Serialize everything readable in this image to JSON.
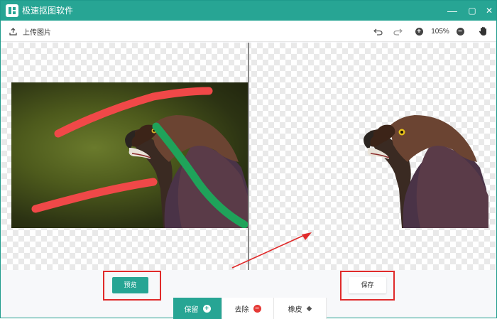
{
  "app": {
    "title": "极速抠图软件"
  },
  "window": {
    "minimize_glyph": "—",
    "maximize_glyph": "▢",
    "close_glyph": "✕"
  },
  "toolbar": {
    "upload_label": "上传图片",
    "zoom_level": "105%",
    "zoom_in_glyph": "+",
    "zoom_out_glyph": "−"
  },
  "actions": {
    "preview_label": "预览",
    "save_label": "保存"
  },
  "tools": [
    {
      "label": "保留",
      "icon": "plus-circle-icon",
      "glyph": "+",
      "active": true
    },
    {
      "label": "去除",
      "icon": "minus-circle-icon",
      "glyph": "−",
      "active": false
    },
    {
      "label": "橡皮",
      "icon": "eraser-icon",
      "glyph": "◆",
      "active": false
    }
  ],
  "colors": {
    "accent": "#27a594",
    "keep_stroke": "#1fa35a",
    "remove_stroke": "#f04848",
    "annotation_red": "#e02a2a"
  }
}
